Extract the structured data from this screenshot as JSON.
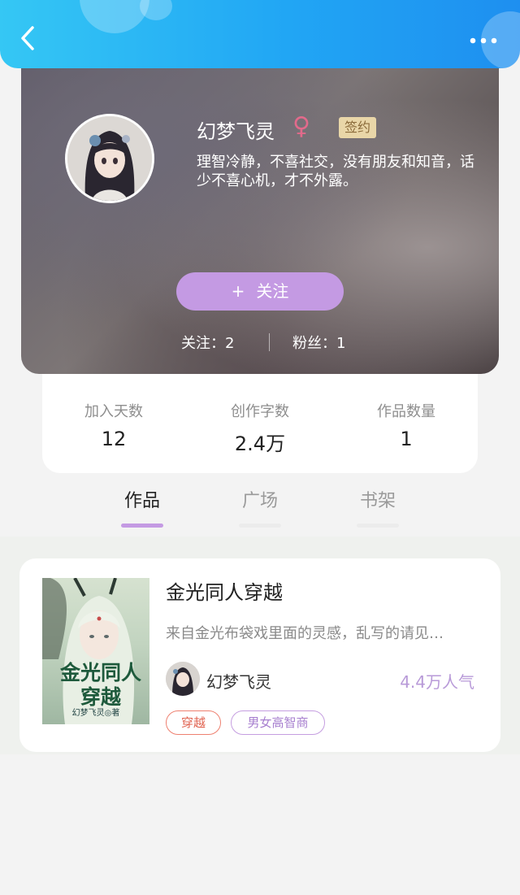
{
  "profile": {
    "name": "幻梦飞灵",
    "gender_symbol": "♀",
    "badge": "签约",
    "bio": "理智冷静，不喜社交，没有朋友和知音，话少不喜心机，才不外露。",
    "follow_button": "关注",
    "follow_plus": "+",
    "following": "关注：2",
    "fans": "粉丝：1"
  },
  "stats": [
    {
      "label": "加入天数",
      "value": "12"
    },
    {
      "label": "创作字数",
      "value": "2.4万"
    },
    {
      "label": "作品数量",
      "value": "1"
    }
  ],
  "tabs": [
    {
      "label": "作品",
      "active": true
    },
    {
      "label": "广场",
      "active": false
    },
    {
      "label": "书架",
      "active": false
    }
  ],
  "book": {
    "title": "金光同人穿越",
    "description": "来自金光布袋戏里面的灵感，乱写的请见…",
    "cover_title": "金光同人穿越",
    "cover_author": "幻梦飞灵◎著",
    "author": "幻梦飞灵",
    "popularity": "4.4万人气",
    "tags": [
      "穿越",
      "男女高智商"
    ]
  },
  "colors": {
    "accent": "#c49ae3",
    "header": "#21a6f4",
    "female": "#e26a8b"
  },
  "icons": {
    "back": "chevron-left-icon",
    "more": "more-horizontal-icon"
  }
}
